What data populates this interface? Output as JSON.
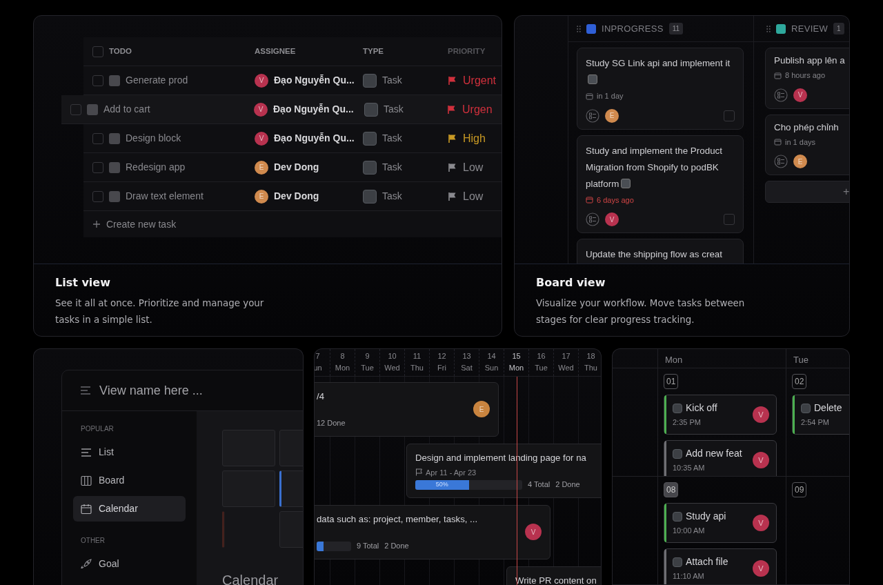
{
  "list_view": {
    "all_checked": false,
    "columns": [
      {
        "label": "TODO"
      },
      {
        "label": "ASSIGNEE"
      },
      {
        "label": "TYPE"
      },
      {
        "label": "PRIORITY"
      }
    ],
    "rows": [
      {
        "title": "Generate prod",
        "checked": false,
        "dragging": false,
        "assignee": {
          "name": "Đạo Nguyễn Qu...",
          "initial": "V",
          "color": "#b8324f"
        },
        "type": "Task",
        "priority": {
          "label": "Urgent",
          "color": "#d0303c"
        }
      },
      {
        "title": "Add to cart",
        "checked": false,
        "dragging": true,
        "assignee": {
          "name": "Đạo Nguyễn Qu...",
          "initial": "V",
          "color": "#b8324f"
        },
        "type": "Task",
        "priority": {
          "label": "Urgen",
          "color": "#d0303c"
        }
      },
      {
        "title": "Design block",
        "checked": false,
        "dragging": false,
        "assignee": {
          "name": "Đạo Nguyễn Qu...",
          "initial": "V",
          "color": "#b8324f"
        },
        "type": "Task",
        "priority": {
          "label": "High",
          "color": "#c99a24"
        }
      },
      {
        "title": "Redesign app",
        "checked": false,
        "dragging": false,
        "assignee": {
          "name": "Dev Dong",
          "initial": "E",
          "color": "#d08a4e"
        },
        "type": "Task",
        "priority": {
          "label": "Low",
          "color": "#8a8a8f"
        }
      },
      {
        "title": "Draw text element",
        "checked": false,
        "dragging": false,
        "assignee": {
          "name": "Dev Dong",
          "initial": "E",
          "color": "#d08a4e"
        },
        "type": "Task",
        "priority": {
          "label": "Low",
          "color": "#8a8a8f"
        }
      }
    ],
    "create_label": "Create new task",
    "caption": {
      "title": "List view",
      "description": "See it all at once. Prioritize and manage your tasks in a simple list."
    }
  },
  "board_view": {
    "columns": [
      {
        "title": "INPROGRESS",
        "count": "11",
        "color": "#2f5fd6",
        "cards": [
          {
            "title": "Study SG Link api and implement it",
            "tagged": true,
            "due": "in 1 day",
            "overdue": false,
            "assignee": {
              "initial": "E",
              "color": "#d08a4e"
            },
            "checked": false
          },
          {
            "title": "Study and implement the Product Migration from Shopify to podBK platform",
            "tagged": true,
            "due": "6 days ago",
            "overdue": true,
            "assignee": {
              "initial": "V",
              "color": "#b8324f"
            },
            "checked": false
          },
          {
            "title": "Update the shipping flow as creat",
            "tagged": false
          }
        ]
      },
      {
        "title": "REVIEW",
        "count": "1",
        "color": "#2ea89c",
        "cards": [
          {
            "title": "Publish app lên a",
            "tagged": false,
            "due": "8 hours ago",
            "overdue": false,
            "assignee": {
              "initial": "V",
              "color": "#b8324f"
            }
          },
          {
            "title": "Cho phép chỉnh",
            "tagged": false,
            "due": "in 1 days",
            "overdue": false,
            "assignee": {
              "initial": "E",
              "color": "#d08a4e"
            }
          }
        ],
        "add_label": "+"
      }
    ],
    "caption": {
      "title": "Board view",
      "description": "Visualize your workflow. Move tasks between stages for clear progress tracking."
    }
  },
  "view_picker": {
    "placeholder": "View name here ...",
    "sections": [
      {
        "heading": "POPULAR",
        "items": [
          {
            "label": "List",
            "kind": "list",
            "selected": false
          },
          {
            "label": "Board",
            "kind": "board",
            "selected": false
          },
          {
            "label": "Calendar",
            "kind": "calendar",
            "selected": true
          }
        ]
      },
      {
        "heading": "OTHER",
        "items": [
          {
            "label": "Goal",
            "kind": "goal",
            "selected": false
          }
        ]
      }
    ],
    "preview_label": "Calendar"
  },
  "timeline": {
    "days": [
      {
        "date": "7",
        "weekday": "un",
        "today": false
      },
      {
        "date": "8",
        "weekday": "Mon",
        "today": false
      },
      {
        "date": "9",
        "weekday": "Tue",
        "today": false
      },
      {
        "date": "10",
        "weekday": "Wed",
        "today": false
      },
      {
        "date": "11",
        "weekday": "Thu",
        "today": false
      },
      {
        "date": "12",
        "weekday": "Fri",
        "today": false
      },
      {
        "date": "13",
        "weekday": "Sat",
        "today": false
      },
      {
        "date": "14",
        "weekday": "Sun",
        "today": false
      },
      {
        "date": "15",
        "weekday": "Mon",
        "today": true
      },
      {
        "date": "16",
        "weekday": "Tue",
        "today": false
      },
      {
        "date": "17",
        "weekday": "Wed",
        "today": false
      },
      {
        "date": "18",
        "weekday": "Thu",
        "today": false
      }
    ],
    "bars": [
      {
        "title": "/4",
        "assignee": {
          "initial": "E",
          "color": "#c9843f"
        },
        "stats": [
          "12 Done"
        ]
      },
      {
        "title": "Design and implement landing page for na",
        "dates": "Apr 11 - Apr 23",
        "progress": {
          "level": 0.5,
          "label": "50%"
        },
        "stats": [
          "4 Total",
          "2 Done"
        ]
      },
      {
        "title": "data such as: project, member, tasks, ...",
        "assignee": {
          "initial": "V",
          "color": "#b8324f"
        },
        "progress": {
          "level": 0.2
        },
        "stats": [
          "9 Total",
          "2 Done"
        ]
      },
      {
        "title": "Write PR content on"
      }
    ]
  },
  "calendar": {
    "weekdays": [
      {
        "label": "Mon"
      },
      {
        "label": "Tue"
      }
    ],
    "weeks": [
      {
        "days": [
          {
            "date": "01",
            "today": false,
            "events": [
              {
                "title": "Kick off",
                "time": "2:35 PM",
                "color": "#4caf50",
                "assignee": {
                  "initial": "V",
                  "color": "#b8324f"
                }
              },
              {
                "title": "Add new feat",
                "time": "10:35 AM",
                "color": "#6e6e73",
                "assignee": {
                  "initial": "V",
                  "color": "#b8324f"
                }
              }
            ]
          },
          {
            "date": "02",
            "today": false,
            "events": [
              {
                "title": "Delete",
                "time": "2:54 PM",
                "color": "#4caf50"
              }
            ]
          }
        ]
      },
      {
        "days": [
          {
            "date": "08",
            "today": true,
            "events": [
              {
                "title": "Study api",
                "time": "10:00 AM",
                "color": "#4caf50",
                "assignee": {
                  "initial": "V",
                  "color": "#b8324f"
                }
              },
              {
                "title": "Attach file",
                "time": "11:10 AM",
                "color": "#6e6e73",
                "assignee": {
                  "initial": "V",
                  "color": "#b8324f"
                }
              }
            ]
          },
          {
            "date": "09",
            "today": false
          }
        ]
      }
    ]
  }
}
